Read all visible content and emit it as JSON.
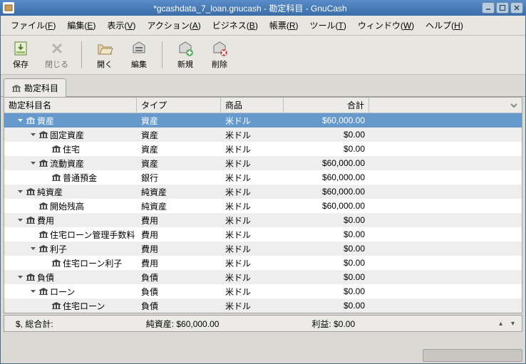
{
  "window": {
    "title": "*gcashdata_7_loan.gnucash - 勘定科目 - GnuCash"
  },
  "menubar": {
    "items": [
      {
        "label": "ファイル",
        "key": "F"
      },
      {
        "label": "編集",
        "key": "E"
      },
      {
        "label": "表示",
        "key": "V"
      },
      {
        "label": "アクション",
        "key": "A"
      },
      {
        "label": "ビジネス",
        "key": "B"
      },
      {
        "label": "帳票",
        "key": "R"
      },
      {
        "label": "ツール",
        "key": "T"
      },
      {
        "label": "ウィンドウ",
        "key": "W"
      },
      {
        "label": "ヘルプ",
        "key": "H"
      }
    ]
  },
  "toolbar": {
    "save": "保存",
    "close": "閉じる",
    "open": "開く",
    "edit": "編集",
    "new": "新規",
    "delete": "削除"
  },
  "tab": {
    "label": "勘定科目"
  },
  "columns": {
    "name": "勘定科目名",
    "type": "タイプ",
    "commodity": "商品",
    "total": "合計"
  },
  "rows": [
    {
      "indent": 0,
      "expander": "down",
      "name": "資産",
      "type": "資産",
      "commodity": "米ドル",
      "total": "$60,000.00",
      "selected": true
    },
    {
      "indent": 1,
      "expander": "down",
      "name": "固定資産",
      "type": "資産",
      "commodity": "米ドル",
      "total": "$0.00"
    },
    {
      "indent": 2,
      "expander": "none",
      "name": "住宅",
      "type": "資産",
      "commodity": "米ドル",
      "total": "$0.00"
    },
    {
      "indent": 1,
      "expander": "down",
      "name": "流動資産",
      "type": "資産",
      "commodity": "米ドル",
      "total": "$60,000.00"
    },
    {
      "indent": 2,
      "expander": "none",
      "name": "普通預金",
      "type": "銀行",
      "commodity": "米ドル",
      "total": "$60,000.00"
    },
    {
      "indent": 0,
      "expander": "down",
      "name": "純資産",
      "type": "純資産",
      "commodity": "米ドル",
      "total": "$60,000.00"
    },
    {
      "indent": 1,
      "expander": "none",
      "name": "開始残高",
      "type": "純資産",
      "commodity": "米ドル",
      "total": "$60,000.00"
    },
    {
      "indent": 0,
      "expander": "down",
      "name": "費用",
      "type": "費用",
      "commodity": "米ドル",
      "total": "$0.00"
    },
    {
      "indent": 1,
      "expander": "none",
      "name": "住宅ローン管理手数料",
      "type": "費用",
      "commodity": "米ドル",
      "total": "$0.00"
    },
    {
      "indent": 1,
      "expander": "down",
      "name": "利子",
      "type": "費用",
      "commodity": "米ドル",
      "total": "$0.00"
    },
    {
      "indent": 2,
      "expander": "none",
      "name": "住宅ローン利子",
      "type": "費用",
      "commodity": "米ドル",
      "total": "$0.00"
    },
    {
      "indent": 0,
      "expander": "down",
      "name": "負債",
      "type": "負債",
      "commodity": "米ドル",
      "total": "$0.00"
    },
    {
      "indent": 1,
      "expander": "down",
      "name": "ローン",
      "type": "負債",
      "commodity": "米ドル",
      "total": "$0.00"
    },
    {
      "indent": 2,
      "expander": "none",
      "name": "住宅ローン",
      "type": "負債",
      "commodity": "米ドル",
      "total": "$0.00"
    }
  ],
  "statusbar": {
    "grand_total_label": "$, 総合計:",
    "net_assets": "純資産: $60,000.00",
    "profit": "利益: $0.00"
  }
}
